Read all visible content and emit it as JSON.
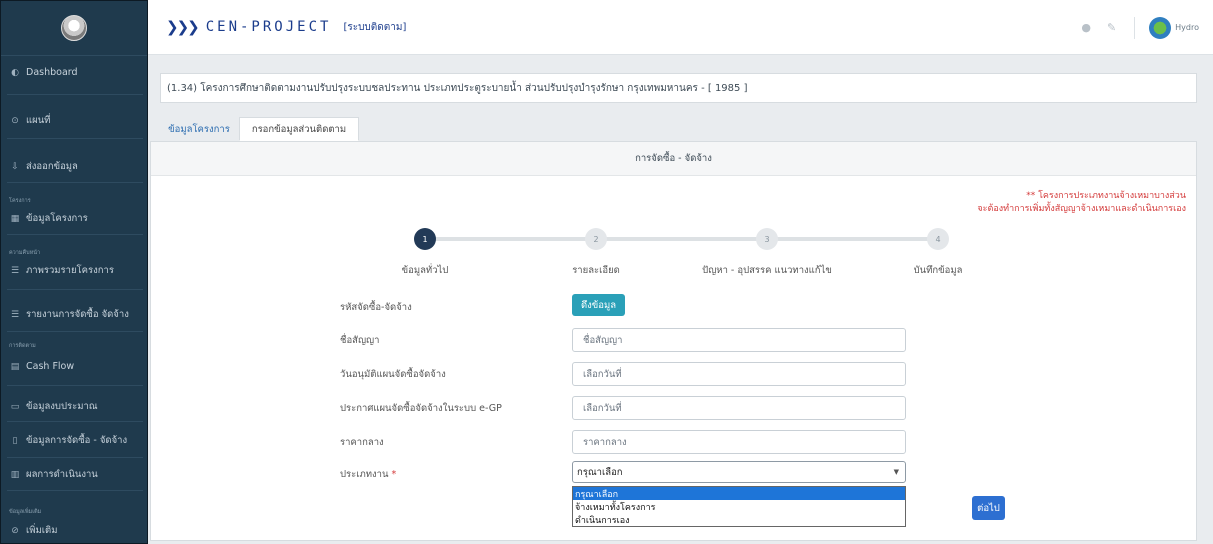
{
  "sidebar": {
    "items": [
      {
        "label": "Dashboard",
        "icon": "dashboard-icon"
      },
      {
        "label": "แผนที่",
        "icon": "map-pin-icon"
      },
      {
        "label": "ส่งออกข้อมูล",
        "icon": "export-icon"
      },
      {
        "label": "ข้อมูลโครงการ",
        "icon": "table-icon"
      },
      {
        "label": "ภาพรวมรายโครงการ",
        "icon": "list-icon"
      },
      {
        "label": "รายงานการจัดซื้อ จัดจ้าง",
        "icon": "list-icon"
      },
      {
        "label": "Cash Flow",
        "icon": "money-icon"
      },
      {
        "label": "ข้อมูลงบประมาณ",
        "icon": "budget-icon"
      },
      {
        "label": "ข้อมูลการจัดซื้อ - จัดจ้าง",
        "icon": "document-icon"
      },
      {
        "label": "ผลการดำเนินงาน",
        "icon": "bar-chart-icon"
      },
      {
        "label": "เพิ่มเติม",
        "icon": "info-icon"
      }
    ],
    "sections": [
      "โครงการ",
      "ความคืบหน้า",
      "การติดตาม",
      "ข้อมูลเพิ่มเติม"
    ]
  },
  "header": {
    "brand": "CEN-PROJECT",
    "subtitle": "[ระบบติดตาม]",
    "user_name": "Hydro"
  },
  "project_title": "(1.34) โครงการศึกษาติดตามงานปรับปรุงระบบชลประทาน ประเภทประตูระบายน้ำ ส่วนปรับปรุงบำรุงรักษา กรุงเทพมหานคร - [ 1985 ]",
  "tabs": [
    "ข้อมูลโครงการ",
    "กรอกข้อมูลส่วนติดตาม"
  ],
  "card": {
    "title": "การจัดซื้อ - จัดจ้าง",
    "note_line1": "** โครงการประเภทงานจ้างเหมาบางส่วน",
    "note_line2": "จะต้องทำการเพิ่มทั้งสัญญาจ้างเหมาและดำเนินการเอง"
  },
  "steps": [
    {
      "num": "1",
      "label": "ข้อมูลทั่วไป",
      "active": true
    },
    {
      "num": "2",
      "label": "รายละเอียด",
      "active": false
    },
    {
      "num": "3",
      "label": "ปัญหา - อุปสรรค แนวทางแก้ไข",
      "active": false
    },
    {
      "num": "4",
      "label": "บันทึกข้อมูล",
      "active": false
    }
  ],
  "form": {
    "procurement_code_label": "รหัสจัดซื้อ-จัดจ้าง",
    "fetch_button": "ดึงข้อมูล",
    "contract_name_label": "ชื่อสัญญา",
    "contract_name_placeholder": "ชื่อสัญญา",
    "plan_approval_label": "วันอนุมัติแผนจัดซื้อจัดจ้าง",
    "plan_approval_placeholder": "เลือกวันที่",
    "egp_label": "ประกาศแผนจัดซื้อจัดจ้างในระบบ e-GP",
    "egp_placeholder": "เลือกวันที่",
    "median_price_label": "ราคากลาง",
    "median_price_placeholder": "ราคากลาง",
    "work_type_label": "ประเภทงาน",
    "work_type_required": "*",
    "work_type_selected": "กรุณาเลือก",
    "work_type_options": [
      "กรุณาเลือก",
      "จ้างเหมาทั้งโครงการ",
      "ดำเนินการเอง"
    ],
    "next_button": "ต่อไป"
  }
}
